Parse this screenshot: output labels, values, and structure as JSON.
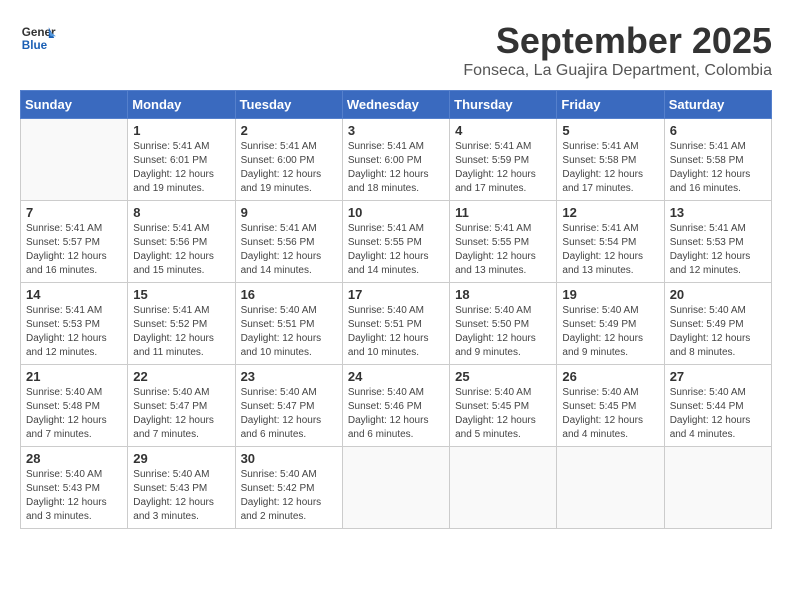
{
  "logo": {
    "line1": "General",
    "line2": "Blue"
  },
  "title": "September 2025",
  "location": "Fonseca, La Guajira Department, Colombia",
  "days_of_week": [
    "Sunday",
    "Monday",
    "Tuesday",
    "Wednesday",
    "Thursday",
    "Friday",
    "Saturday"
  ],
  "weeks": [
    [
      {
        "day": "",
        "info": ""
      },
      {
        "day": "1",
        "info": "Sunrise: 5:41 AM\nSunset: 6:01 PM\nDaylight: 12 hours\nand 19 minutes."
      },
      {
        "day": "2",
        "info": "Sunrise: 5:41 AM\nSunset: 6:00 PM\nDaylight: 12 hours\nand 19 minutes."
      },
      {
        "day": "3",
        "info": "Sunrise: 5:41 AM\nSunset: 6:00 PM\nDaylight: 12 hours\nand 18 minutes."
      },
      {
        "day": "4",
        "info": "Sunrise: 5:41 AM\nSunset: 5:59 PM\nDaylight: 12 hours\nand 17 minutes."
      },
      {
        "day": "5",
        "info": "Sunrise: 5:41 AM\nSunset: 5:58 PM\nDaylight: 12 hours\nand 17 minutes."
      },
      {
        "day": "6",
        "info": "Sunrise: 5:41 AM\nSunset: 5:58 PM\nDaylight: 12 hours\nand 16 minutes."
      }
    ],
    [
      {
        "day": "7",
        "info": "Sunrise: 5:41 AM\nSunset: 5:57 PM\nDaylight: 12 hours\nand 16 minutes."
      },
      {
        "day": "8",
        "info": "Sunrise: 5:41 AM\nSunset: 5:56 PM\nDaylight: 12 hours\nand 15 minutes."
      },
      {
        "day": "9",
        "info": "Sunrise: 5:41 AM\nSunset: 5:56 PM\nDaylight: 12 hours\nand 14 minutes."
      },
      {
        "day": "10",
        "info": "Sunrise: 5:41 AM\nSunset: 5:55 PM\nDaylight: 12 hours\nand 14 minutes."
      },
      {
        "day": "11",
        "info": "Sunrise: 5:41 AM\nSunset: 5:55 PM\nDaylight: 12 hours\nand 13 minutes."
      },
      {
        "day": "12",
        "info": "Sunrise: 5:41 AM\nSunset: 5:54 PM\nDaylight: 12 hours\nand 13 minutes."
      },
      {
        "day": "13",
        "info": "Sunrise: 5:41 AM\nSunset: 5:53 PM\nDaylight: 12 hours\nand 12 minutes."
      }
    ],
    [
      {
        "day": "14",
        "info": "Sunrise: 5:41 AM\nSunset: 5:53 PM\nDaylight: 12 hours\nand 12 minutes."
      },
      {
        "day": "15",
        "info": "Sunrise: 5:41 AM\nSunset: 5:52 PM\nDaylight: 12 hours\nand 11 minutes."
      },
      {
        "day": "16",
        "info": "Sunrise: 5:40 AM\nSunset: 5:51 PM\nDaylight: 12 hours\nand 10 minutes."
      },
      {
        "day": "17",
        "info": "Sunrise: 5:40 AM\nSunset: 5:51 PM\nDaylight: 12 hours\nand 10 minutes."
      },
      {
        "day": "18",
        "info": "Sunrise: 5:40 AM\nSunset: 5:50 PM\nDaylight: 12 hours\nand 9 minutes."
      },
      {
        "day": "19",
        "info": "Sunrise: 5:40 AM\nSunset: 5:49 PM\nDaylight: 12 hours\nand 9 minutes."
      },
      {
        "day": "20",
        "info": "Sunrise: 5:40 AM\nSunset: 5:49 PM\nDaylight: 12 hours\nand 8 minutes."
      }
    ],
    [
      {
        "day": "21",
        "info": "Sunrise: 5:40 AM\nSunset: 5:48 PM\nDaylight: 12 hours\nand 7 minutes."
      },
      {
        "day": "22",
        "info": "Sunrise: 5:40 AM\nSunset: 5:47 PM\nDaylight: 12 hours\nand 7 minutes."
      },
      {
        "day": "23",
        "info": "Sunrise: 5:40 AM\nSunset: 5:47 PM\nDaylight: 12 hours\nand 6 minutes."
      },
      {
        "day": "24",
        "info": "Sunrise: 5:40 AM\nSunset: 5:46 PM\nDaylight: 12 hours\nand 6 minutes."
      },
      {
        "day": "25",
        "info": "Sunrise: 5:40 AM\nSunset: 5:45 PM\nDaylight: 12 hours\nand 5 minutes."
      },
      {
        "day": "26",
        "info": "Sunrise: 5:40 AM\nSunset: 5:45 PM\nDaylight: 12 hours\nand 4 minutes."
      },
      {
        "day": "27",
        "info": "Sunrise: 5:40 AM\nSunset: 5:44 PM\nDaylight: 12 hours\nand 4 minutes."
      }
    ],
    [
      {
        "day": "28",
        "info": "Sunrise: 5:40 AM\nSunset: 5:43 PM\nDaylight: 12 hours\nand 3 minutes."
      },
      {
        "day": "29",
        "info": "Sunrise: 5:40 AM\nSunset: 5:43 PM\nDaylight: 12 hours\nand 3 minutes."
      },
      {
        "day": "30",
        "info": "Sunrise: 5:40 AM\nSunset: 5:42 PM\nDaylight: 12 hours\nand 2 minutes."
      },
      {
        "day": "",
        "info": ""
      },
      {
        "day": "",
        "info": ""
      },
      {
        "day": "",
        "info": ""
      },
      {
        "day": "",
        "info": ""
      }
    ]
  ]
}
